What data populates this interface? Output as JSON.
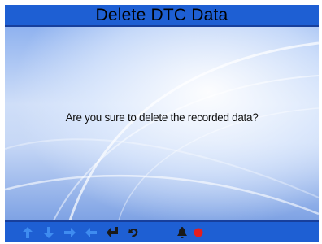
{
  "screen": {
    "title": "Delete DTC Data",
    "message": "Are you sure to delete the recorded data?"
  },
  "bottom_bar": {
    "icons": [
      "up-arrow-icon",
      "down-arrow-icon",
      "right-arrow-icon",
      "left-arrow-icon",
      "enter-icon",
      "back-icon",
      "help-bell-icon",
      "record-icon"
    ]
  },
  "colors": {
    "bar_blue": "#1e5fd3",
    "icon_blue": "#3f8cf0",
    "record_red": "#e61e1e"
  }
}
